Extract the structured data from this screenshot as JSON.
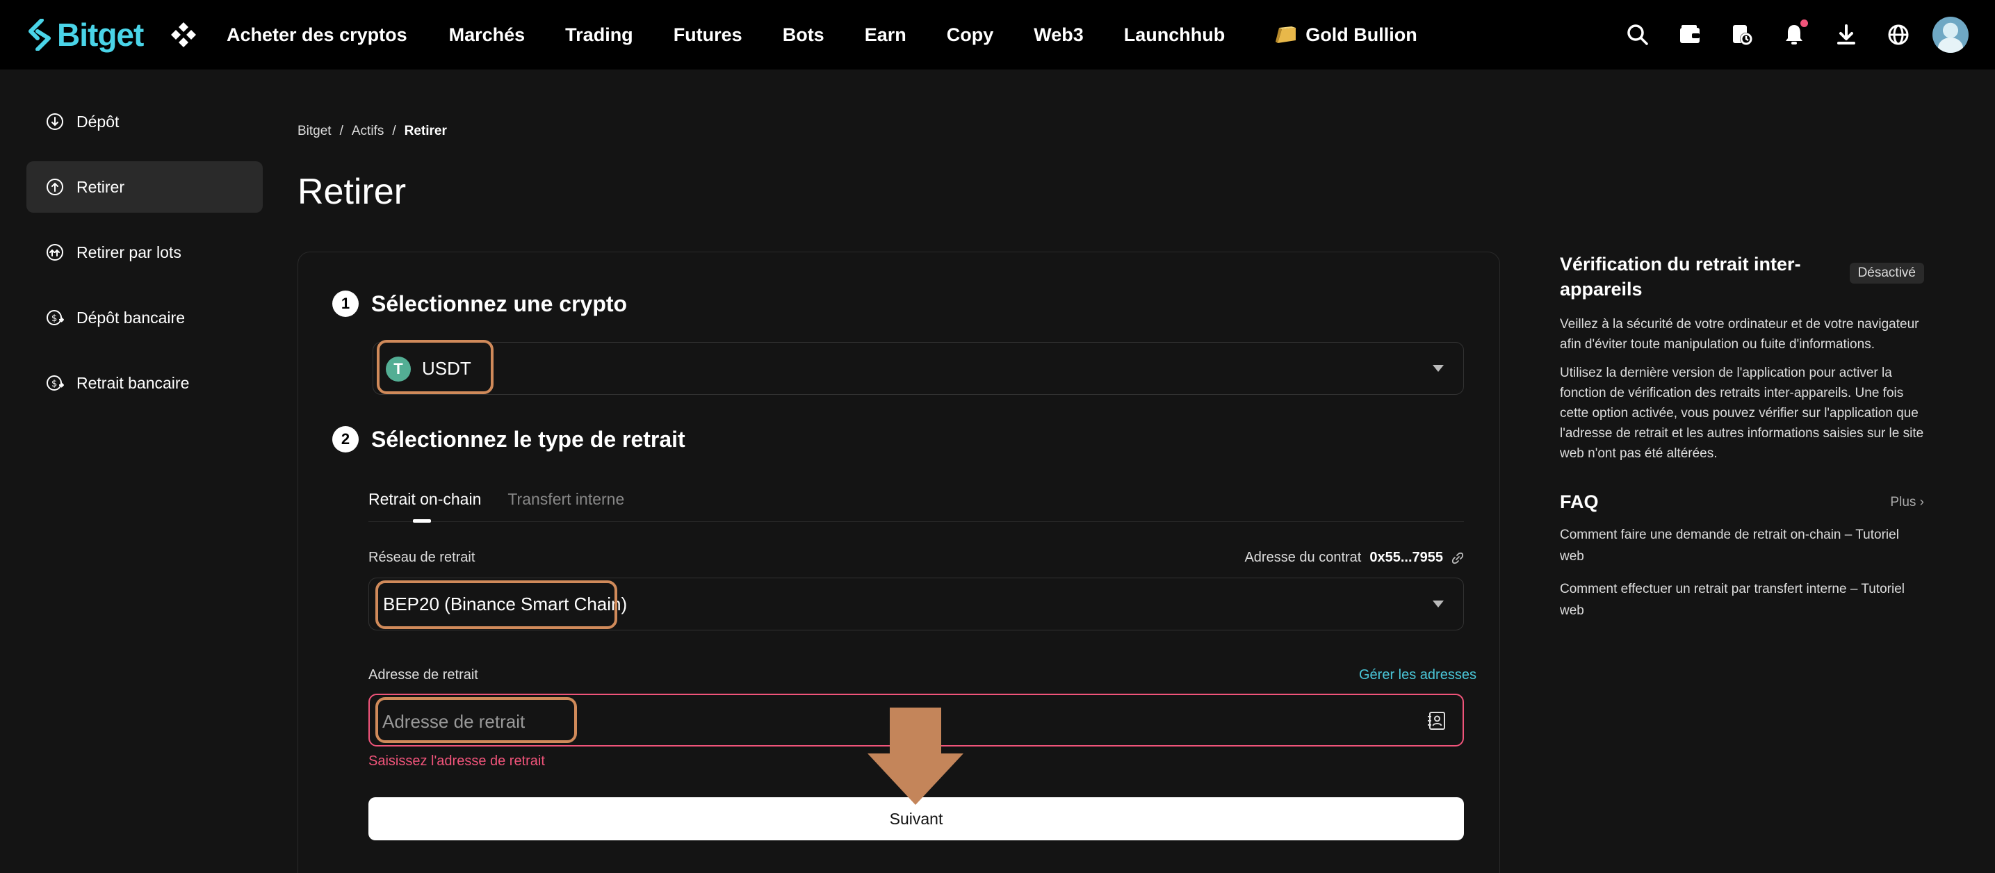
{
  "brand": {
    "name": "Bitget",
    "accent": "#4ad4e8"
  },
  "nav": {
    "items": [
      "Acheter des cryptos",
      "Marchés",
      "Trading",
      "Futures",
      "Bots",
      "Earn",
      "Copy",
      "Web3",
      "Launchhub"
    ],
    "gold": "Gold Bullion"
  },
  "top_icons": [
    "search-icon",
    "wallet-icon",
    "orders-clock-icon",
    "bell-icon",
    "download-icon",
    "globe-icon"
  ],
  "sidebar": {
    "items": [
      {
        "label": "Dépôt",
        "icon": "deposit-icon"
      },
      {
        "label": "Retirer",
        "icon": "withdraw-icon"
      },
      {
        "label": "Retirer par lots",
        "icon": "batch-withdraw-icon"
      },
      {
        "label": "Dépôt bancaire",
        "icon": "bank-deposit-icon"
      },
      {
        "label": "Retrait bancaire",
        "icon": "bank-withdraw-icon"
      }
    ],
    "active_index": 1
  },
  "breadcrumb": {
    "items": [
      "Bitget",
      "Actifs",
      "Retirer"
    ],
    "separator": "/"
  },
  "page_title": "Retirer",
  "step1": {
    "num": "1",
    "title": "Sélectionnez une crypto",
    "coin_symbol": "T",
    "coin": "USDT"
  },
  "step2": {
    "num": "2",
    "title": "Sélectionnez le type de retrait",
    "tabs": [
      "Retrait on-chain",
      "Transfert interne"
    ],
    "network_label": "Réseau de retrait",
    "contract_label": "Adresse du contrat",
    "contract_value": "0x55...7955",
    "network_value": "BEP20 (Binance Smart Chain)",
    "address_label": "Adresse de retrait",
    "manage_addresses": "Gérer les adresses",
    "address_placeholder": "Adresse de retrait",
    "address_error": "Saisissez l'adresse de retrait",
    "next_button": "Suivant"
  },
  "right": {
    "verification_title": "Vérification du retrait inter-appareils",
    "verification_status": "Désactivé",
    "para1": "Veillez à la sécurité de votre ordinateur et de votre navigateur afin d'éviter toute manipulation ou fuite d'informations.",
    "para2": "Utilisez la dernière version de l'application pour activer la fonction de vérification des retraits inter-appareils. Une fois cette option activée, vous pouvez vérifier sur l'application que l'adresse de retrait et les autres informations saisies sur le site web n'ont pas été altérées.",
    "faq_title": "FAQ",
    "faq_more": "Plus ›",
    "faq_links": [
      "Comment faire une demande de retrait on-chain – Tutoriel web",
      "Comment effectuer un retrait par transfert interne – Tutoriel web"
    ]
  },
  "colors": {
    "highlight": "#d08a5a",
    "error": "#f0547a",
    "link": "#4ac6d8"
  }
}
